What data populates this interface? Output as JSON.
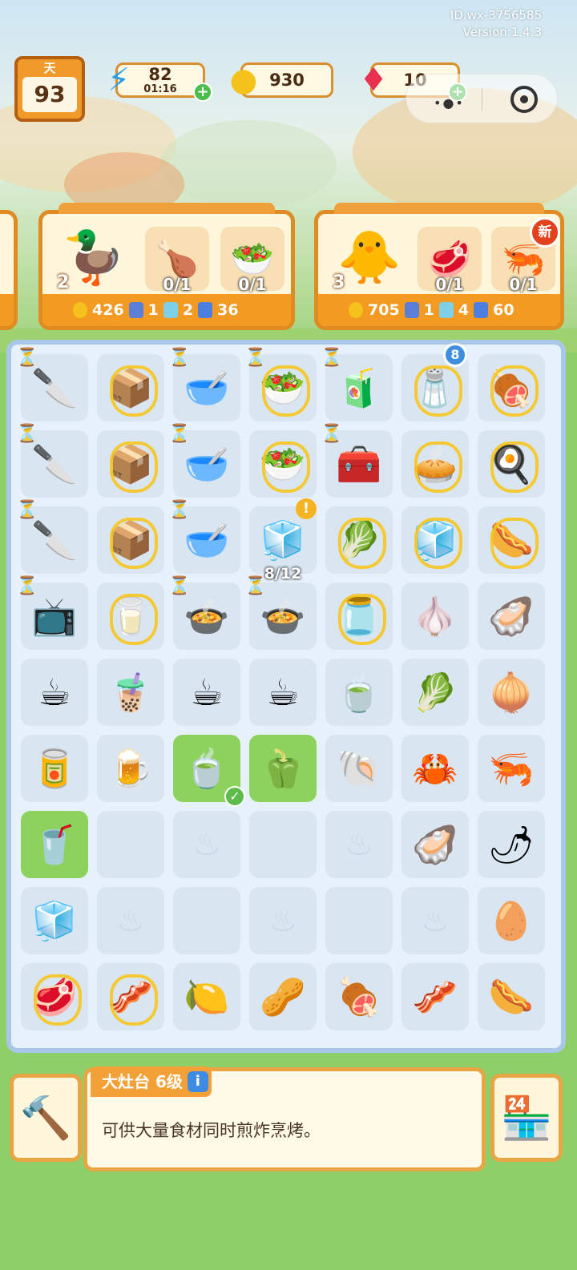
{
  "meta": {
    "id": "ID.wx-3756585",
    "version": "Version:1.4.3"
  },
  "topbar": {
    "day_label": "天",
    "day_value": "93",
    "energy": {
      "value": "82",
      "timer": "01:16",
      "icon": "lightning-icon"
    },
    "coins": {
      "value": "930",
      "icon": "chef-coin-icon"
    },
    "gems": {
      "value": "10",
      "icon": "ruby-icon"
    }
  },
  "orders": [
    {
      "customer": "duck-with-curlers",
      "count": "2",
      "items": [
        {
          "name": "roast-chicken",
          "progress": "0/1"
        },
        {
          "name": "fruit-salad",
          "progress": "0/1"
        }
      ],
      "rewards": {
        "coins": "426",
        "card": "1",
        "drink": "2",
        "energy": "36"
      }
    },
    {
      "customer": "white-duck",
      "count": "3",
      "items": [
        {
          "name": "steak-dish",
          "progress": "0/1"
        },
        {
          "name": "shrimp-dish",
          "progress": "0/1",
          "badge": "新"
        }
      ],
      "rewards": {
        "coins": "705",
        "card": "1",
        "drink": "4",
        "energy": "60"
      }
    }
  ],
  "board": {
    "rows": [
      [
        {
          "item": "cutting-board-station",
          "emoji": "🔪",
          "timer": true
        },
        {
          "item": "blue-fryer",
          "emoji": "📦",
          "lock": true
        },
        {
          "item": "green-mixer",
          "emoji": "🥣",
          "timer": true
        },
        {
          "item": "fruit-bowl",
          "emoji": "🥗",
          "lock": true,
          "timer": true
        },
        {
          "item": "juice-blender",
          "emoji": "🧃",
          "timer": true
        },
        {
          "item": "spice-rack",
          "emoji": "🧂",
          "lock": true,
          "badge": "8"
        },
        {
          "item": "grill-tool",
          "emoji": "🍖",
          "lock": true
        }
      ],
      [
        {
          "item": "cleaver-station",
          "emoji": "🔪",
          "timer": true
        },
        {
          "item": "blue-fryer",
          "emoji": "📦",
          "lock": true
        },
        {
          "item": "green-mixer",
          "emoji": "🥣",
          "timer": true
        },
        {
          "item": "salad-bowl",
          "emoji": "🥗",
          "lock": true
        },
        {
          "item": "blue-oven",
          "emoji": "🧰",
          "timer": true
        },
        {
          "item": "pie",
          "emoji": "🥧",
          "lock": true
        },
        {
          "item": "frying-pan",
          "emoji": "🍳",
          "lock": true
        }
      ],
      [
        {
          "item": "knife-board",
          "emoji": "🔪",
          "timer": true
        },
        {
          "item": "blue-fryer",
          "emoji": "📦",
          "lock": true
        },
        {
          "item": "green-mixer",
          "emoji": "🥣",
          "timer": true
        },
        {
          "item": "fridge",
          "emoji": "🧊",
          "alert": "!"
        },
        {
          "item": "veggie-crate",
          "emoji": "🥬",
          "lock": true
        },
        {
          "item": "glass-box",
          "emoji": "🧊",
          "lock": true
        },
        {
          "item": "sausage-plate",
          "emoji": "🌭",
          "lock": true
        }
      ],
      [
        {
          "item": "microwave",
          "emoji": "📺",
          "timer": true
        },
        {
          "item": "glass-cup",
          "emoji": "🥛",
          "lock": true
        },
        {
          "item": "soup-pot",
          "emoji": "🍲",
          "timer": true
        },
        {
          "item": "stock-pot",
          "emoji": "🍲",
          "timer": true,
          "label": "8/12"
        },
        {
          "item": "glass-jar",
          "emoji": "🫙",
          "lock": true
        },
        {
          "item": "garlic",
          "emoji": "🧄"
        },
        {
          "item": "oyster",
          "emoji": "🦪"
        }
      ],
      [
        {
          "item": "coffee-cup",
          "emoji": "☕"
        },
        {
          "item": "iced-coffee",
          "emoji": "🧋"
        },
        {
          "item": "latte",
          "emoji": "☕"
        },
        {
          "item": "espresso",
          "emoji": "☕"
        },
        {
          "item": "green-tea",
          "emoji": "🍵"
        },
        {
          "item": "lettuce",
          "emoji": "🥬"
        },
        {
          "item": "onion",
          "emoji": "🧅"
        }
      ],
      [
        {
          "item": "cola-can",
          "emoji": "🥫"
        },
        {
          "item": "beer",
          "emoji": "🍺"
        },
        {
          "item": "tea-cup",
          "emoji": "🍵",
          "hl": true,
          "check": true
        },
        {
          "item": "bell-pepper",
          "emoji": "🫑",
          "hl": true
        },
        {
          "item": "scallop",
          "emoji": "🐚"
        },
        {
          "item": "crab",
          "emoji": "🦀"
        },
        {
          "item": "shrimp",
          "emoji": "🦐"
        }
      ],
      [
        {
          "item": "water-can",
          "emoji": "🥤",
          "hl": true
        },
        {
          "item": "",
          "emoji": "",
          "empty": true,
          "plain": true
        },
        {
          "item": "",
          "emoji": "",
          "empty": true
        },
        {
          "item": "",
          "emoji": "",
          "empty": true,
          "plain": true
        },
        {
          "item": "",
          "emoji": "",
          "empty": true
        },
        {
          "item": "clam",
          "emoji": "🦪"
        },
        {
          "item": "chili",
          "emoji": "🌶"
        }
      ],
      [
        {
          "item": "ice-cubes",
          "emoji": "🧊"
        },
        {
          "item": "",
          "emoji": "",
          "empty": true
        },
        {
          "item": "",
          "emoji": "",
          "empty": true,
          "plain": true
        },
        {
          "item": "",
          "emoji": "",
          "empty": true
        },
        {
          "item": "",
          "emoji": "",
          "empty": true,
          "plain": true
        },
        {
          "item": "",
          "emoji": "",
          "empty": true
        },
        {
          "item": "egg",
          "emoji": "🥚"
        }
      ],
      [
        {
          "item": "meat-case",
          "emoji": "🥩",
          "lock": true
        },
        {
          "item": "bacon-board",
          "emoji": "🥓",
          "lock": true
        },
        {
          "item": "lemon",
          "emoji": "🍋"
        },
        {
          "item": "peanuts",
          "emoji": "🥜"
        },
        {
          "item": "ham",
          "emoji": "🍖"
        },
        {
          "item": "ham-slices",
          "emoji": "🥓"
        },
        {
          "item": "sausage",
          "emoji": "🌭"
        }
      ]
    ]
  },
  "info": {
    "title": "大灶台 6级",
    "info_icon": "i",
    "description": "可供大量食材同时煎炸烹烤。"
  },
  "colors": {
    "accent": "#f09a2b",
    "board_bg": "#e7f1fb",
    "highlight": "#8ed25e"
  }
}
